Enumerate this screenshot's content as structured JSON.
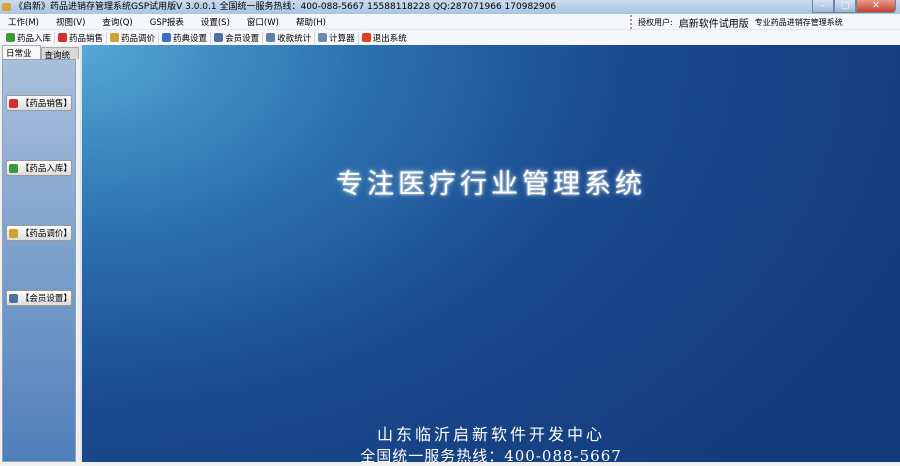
{
  "window": {
    "title": "《启新》药品进销存管理系统GSP试用版V 3.0.0.1 全国统一服务热线：400-088-5667  15588118228  QQ:287071966 170982906",
    "min": "–",
    "max": "□",
    "close": "✕"
  },
  "menu": [
    "工作(M)",
    "视图(V)",
    "查询(Q)",
    "GSP报表",
    "设置(S)",
    "窗口(W)",
    "帮助(H)"
  ],
  "auth": {
    "label": "授权用户:",
    "user": "启新软件试用版",
    "product": "专业药品进销存管理系统"
  },
  "toolbar": [
    {
      "label": "药品入库",
      "icon": "stock-in-icon",
      "color": "#3a9a3a"
    },
    {
      "label": "药品销售",
      "icon": "sales-icon",
      "color": "#d03030"
    },
    {
      "label": "药品调价",
      "icon": "pencil-icon",
      "color": "#d0a030"
    },
    {
      "label": "药典设置",
      "icon": "globe-icon",
      "color": "#3a70c0"
    },
    {
      "label": "会员设置",
      "icon": "members-icon",
      "color": "#5070a0"
    },
    {
      "label": "收款统计",
      "icon": "magnifier-icon",
      "color": "#6080b0"
    },
    {
      "label": "计算器",
      "icon": "calculator-icon",
      "color": "#6a8ab0"
    },
    {
      "label": "退出系统",
      "icon": "exit-icon",
      "color": "#e04020"
    }
  ],
  "tabs": [
    "日常业务",
    "查询统计"
  ],
  "side_buttons": [
    {
      "label": "【药品销售】",
      "color": "#d03030"
    },
    {
      "label": "【药品入库】",
      "color": "#3a9a3a"
    },
    {
      "label": "【药品调价】",
      "color": "#d0a030"
    },
    {
      "label": "【会员设置】",
      "color": "#5070a0"
    }
  ],
  "main": {
    "slogan": "专注医疗行业管理系统",
    "company": "山东临沂启新软件开发中心",
    "hotline": "全国统一服务热线：400-088-5667"
  }
}
